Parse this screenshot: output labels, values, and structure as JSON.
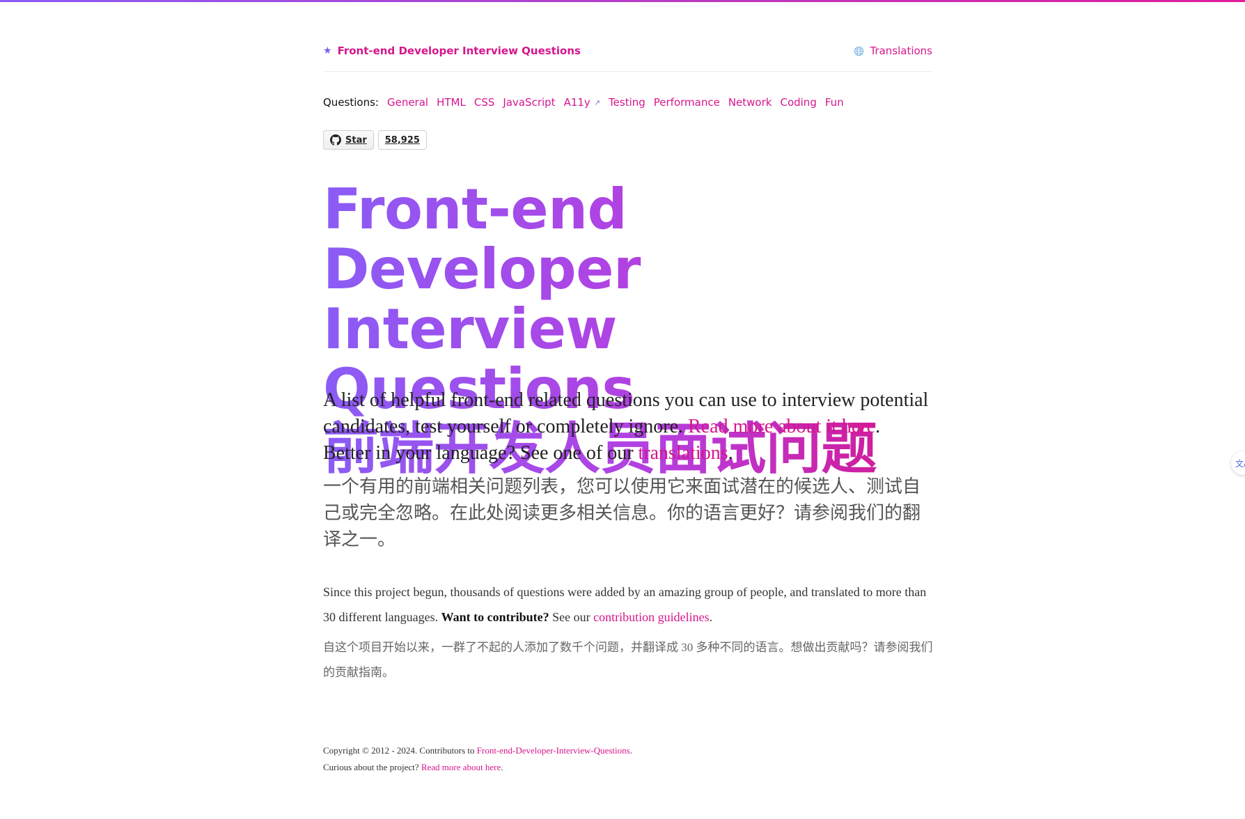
{
  "colors": {
    "accent": "#d6168c",
    "gradient_start": "#8b5cf6",
    "gradient_end": "#d6168c"
  },
  "header": {
    "brand_icon": "star-icon",
    "brand_title": "Front-end Developer Interview Questions",
    "translations_icon": "globe-icon",
    "translations_label": "Translations"
  },
  "nav": {
    "label": "Questions:",
    "items": [
      "General",
      "HTML",
      "CSS",
      "JavaScript",
      "A11y",
      "Testing",
      "Performance",
      "Network",
      "Coding",
      "Fun"
    ],
    "external_icon": "external-link-icon"
  },
  "github": {
    "icon": "github-icon",
    "star_label": "Star",
    "star_count": "58,925"
  },
  "hero": {
    "title_line1": "Front-end Developer",
    "title_line2": "Interview Questions",
    "title_zh": "前端开发人员面试问题"
  },
  "intro": {
    "text_before": "A list of helpful front-end related questions you can use to interview potential candidates, test yourself or completely ignore. ",
    "read_more_link": "Read more about it here",
    "text_middle": ". Better in your language? See one of our ",
    "translations_link": "translations",
    "text_end": ".",
    "zh": "一个有用的前端相关问题列表，您可以使用它来面试潜在的候选人、测试自己或完全忽略。在此处阅读更多相关信息。你的语言更好？请参阅我们的翻译之一。"
  },
  "since": {
    "text": "Since this project begun, thousands of questions were added by an amazing group of people, and translated to more than 30 different languages. ",
    "bold": "Want to contribute?",
    "see_our": " See our ",
    "guidelines_link": "contribution guidelines",
    "end": ".",
    "zh": "自这个项目开始以来，一群了不起的人添加了数千个问题，并翻译成 30 多种不同的语言。想做出贡献吗？请参阅我们的贡献指南。"
  },
  "footer": {
    "copyright_prefix": "Copyright © 2012 - 2024. Contributors to ",
    "repo_link": "Front-end-Developer-Interview-Questions",
    "copyright_end": ".",
    "curious_prefix": "Curious about the project? ",
    "read_more_link": "Read more about here",
    "curious_end": "."
  },
  "side_widget": {
    "icon": "translate-icon",
    "label": "文A"
  }
}
